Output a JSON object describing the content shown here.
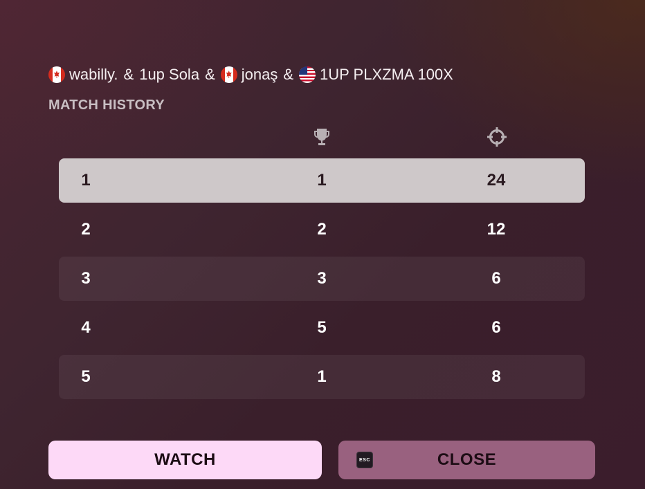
{
  "team": {
    "players": [
      {
        "name": "wabilly.",
        "flag": "canada-flag-icon"
      },
      {
        "name": "1up Sola",
        "flag": ""
      },
      {
        "name": "jonaş",
        "flag": "canada-flag-icon"
      },
      {
        "name": "1UP PLXZMA 100X",
        "flag": "usa-flag-icon"
      }
    ],
    "separator": "&"
  },
  "section_title": "MATCH HISTORY",
  "columns": [
    {
      "icon": "match-number-column",
      "label": ""
    },
    {
      "icon": "trophy-icon",
      "label": "placement"
    },
    {
      "icon": "crosshair-icon",
      "label": "eliminations"
    }
  ],
  "matches": [
    {
      "match": "1",
      "placement": "1",
      "eliminations": "24",
      "selected": true
    },
    {
      "match": "2",
      "placement": "2",
      "eliminations": "12"
    },
    {
      "match": "3",
      "placement": "3",
      "eliminations": "6"
    },
    {
      "match": "4",
      "placement": "5",
      "eliminations": "6"
    },
    {
      "match": "5",
      "placement": "1",
      "eliminations": "8"
    }
  ],
  "buttons": {
    "watch_label": "WATCH",
    "close_label": "CLOSE",
    "close_key": "ESC"
  },
  "colors": {
    "watch_button": "#fdd9f7",
    "close_button": "#99617f",
    "selected_row": "#cec8c9"
  }
}
